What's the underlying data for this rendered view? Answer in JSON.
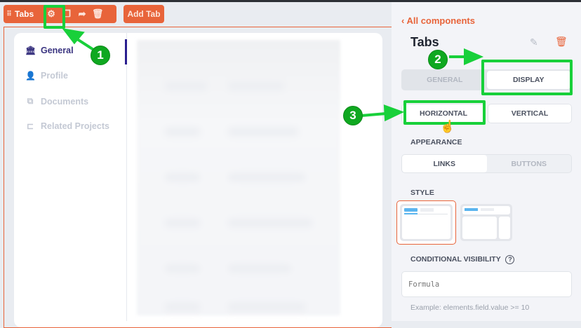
{
  "toolbar": {
    "component_label": "Tabs",
    "add_tab_label": "Add Tab",
    "icons": [
      "drag-handle-icon",
      "gear-icon",
      "copy-icon",
      "share-icon",
      "trash-icon"
    ]
  },
  "tabs_nav": {
    "items": [
      {
        "label": "General",
        "icon": "bank-icon",
        "active": true
      },
      {
        "label": "Profile",
        "icon": "user-icon"
      },
      {
        "label": "Documents",
        "icon": "documents-icon"
      },
      {
        "label": "Related Projects",
        "icon": "projects-icon"
      }
    ]
  },
  "panel": {
    "back_link": "All components",
    "title": "Tabs",
    "section_tabs": [
      "GENERAL",
      "DISPLAY"
    ],
    "section_active": "DISPLAY",
    "orientation": [
      "HORIZONTAL",
      "VERTICAL"
    ],
    "appearance_label": "APPEARANCE",
    "appearance": [
      "LINKS",
      "BUTTONS"
    ],
    "appearance_active": "LINKS",
    "style_label": "STYLE",
    "visibility_label": "CONDITIONAL VISIBILITY",
    "formula_placeholder": "Formula",
    "example": "Example: elements.field.value >= 10"
  },
  "annotations": [
    "1",
    "2",
    "3"
  ],
  "colors": {
    "accent": "#e8643a",
    "annotation": "#18d03a",
    "active_nav": "#2a1f8f"
  }
}
